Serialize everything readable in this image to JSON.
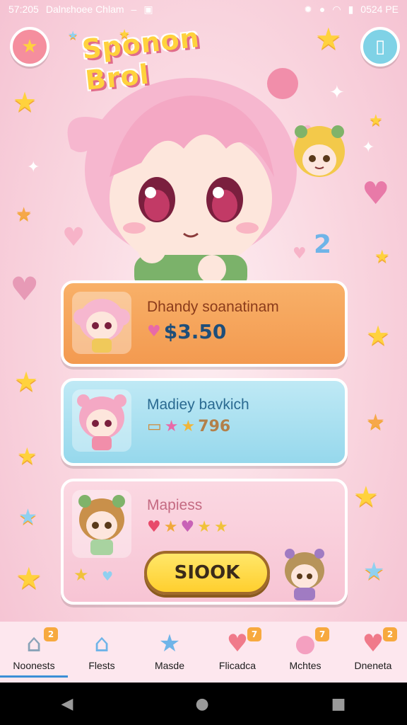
{
  "status_bar": {
    "time": "57:205",
    "app_text": "Dalnɛhoee Chlam",
    "clock": "0524 PE"
  },
  "game": {
    "title": "Sponon Brol"
  },
  "cards": [
    {
      "title": "Dhandy soanatinam",
      "price": "$3.50"
    },
    {
      "title": "Madiey bavkich",
      "score": "796"
    },
    {
      "title": "Mapiess",
      "button_label": "SIOOK"
    }
  ],
  "nav": [
    {
      "label": "Noonests",
      "badge": "2",
      "icon": "house-icon"
    },
    {
      "label": "Flests",
      "badge": "",
      "icon": "home-chef-icon"
    },
    {
      "label": "Masde",
      "badge": "",
      "icon": "star-face-icon"
    },
    {
      "label": "Flicadca",
      "badge": "7",
      "icon": "heart-x-icon"
    },
    {
      "label": "Mchtes",
      "badge": "7",
      "icon": "pig-icon"
    },
    {
      "label": "Dneneta",
      "badge": "2",
      "icon": "heart-apple-icon"
    }
  ],
  "colors": {
    "accent": "#ffd23d",
    "pink": "#f58e9e",
    "blue": "#7fd2e6",
    "orange_card": "#f39a50"
  },
  "deco_glyphs": {
    "star": "★",
    "heart": "♥",
    "sparkle": "✦",
    "two": "2"
  }
}
